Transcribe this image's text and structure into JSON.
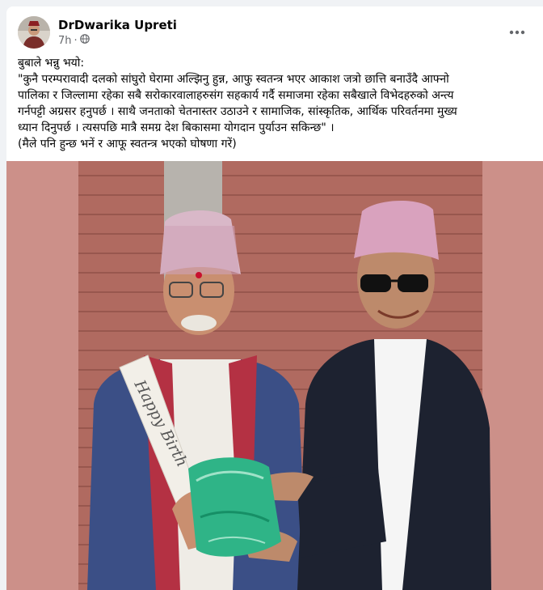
{
  "post": {
    "author": "DrDwarika Upreti",
    "time": "7h",
    "dot": "·",
    "privacy_icon": "globe-icon",
    "more_icon": "more-horizontal-icon",
    "text_lines": [
      "बुबाले भन्नु भयो:",
      "\"कुनै परम्परावादी दलको सांघुरो घेरामा अल्झिनु हुन्न, आफु स्वतन्त्र भएर आकाश जत्रो छात्ति बनाउँदै आफ्नो",
      "पालिका र जिल्लामा रहेका सबै सरोकारवालाहरुसंग सहकार्य गर्दै समाजमा रहेका सबैखाले विभेदहरुको अन्त्य",
      "गर्नपट्टी अग्रसर हनुपर्छ । साथै जनताको चेतनास्तर उठाउने र सामाजिक, सांस्कृतिक, आर्थिक परिवर्तनमा मुख्य",
      "ध्यान दिनुपर्छ । त्यसपछि मात्रै समग्र देश बिकासमा योगदान पुर्याउन सकिन्छ\" ।",
      "(मैले पनि हुन्छ भनें र आफू स्वतन्त्र भएको घोषणा गरें)"
    ],
    "photo": {
      "sash_text": "Happy Birth",
      "colors": {
        "backdrop": "#cc9089",
        "shutter": "#b06a60",
        "gift": "#2fb487",
        "suit_right": "#1d2230",
        "suit_left": "#3b4f86"
      }
    }
  }
}
